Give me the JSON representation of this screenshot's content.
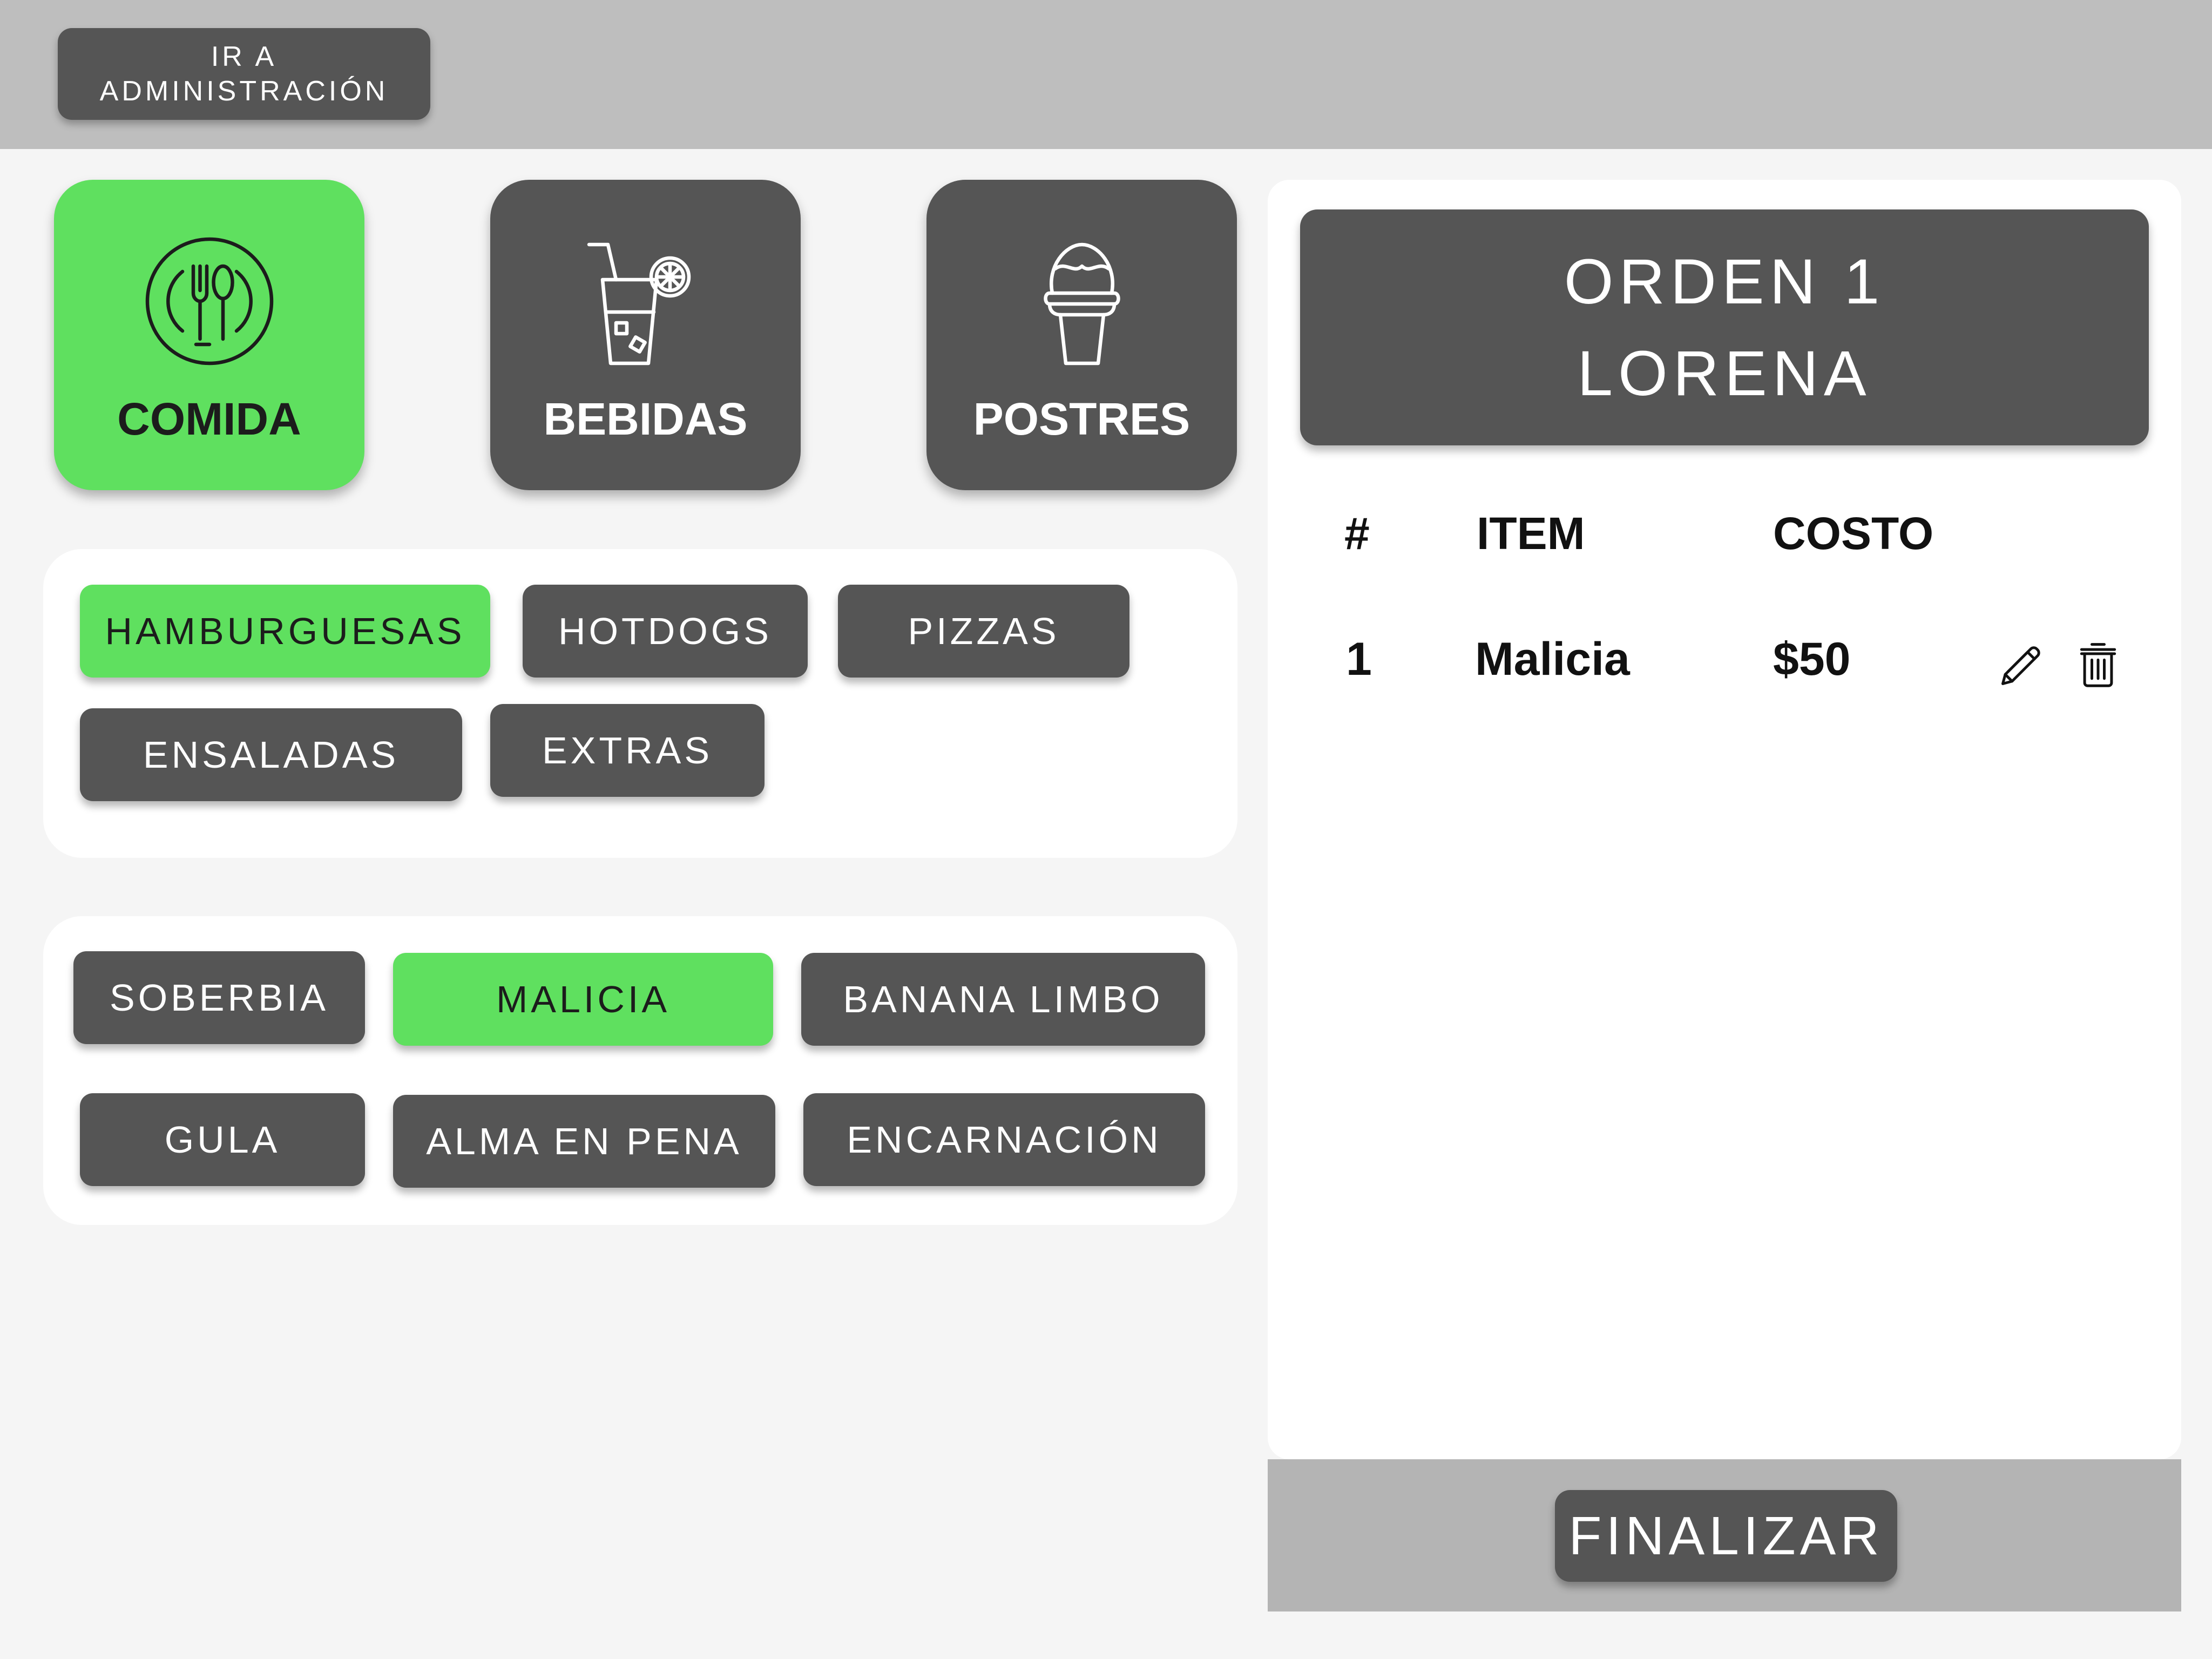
{
  "topbar": {
    "admin_button_line1": "IR A",
    "admin_button_line2": "ADMINISTRACIÓN"
  },
  "categories": [
    {
      "label": "COMIDA",
      "icon": "utensils-icon",
      "active": true
    },
    {
      "label": "BEBIDAS",
      "icon": "drink-icon",
      "active": false
    },
    {
      "label": "POSTRES",
      "icon": "ice-cream-icon",
      "active": false
    }
  ],
  "subcategories": [
    {
      "label": "HAMBURGUESAS",
      "active": true
    },
    {
      "label": "HOTDOGS",
      "active": false
    },
    {
      "label": "PIZZAS",
      "active": false
    },
    {
      "label": "ENSALADAS",
      "active": false
    },
    {
      "label": "EXTRAS",
      "active": false
    }
  ],
  "products": [
    {
      "label": "SOBERBIA",
      "active": false
    },
    {
      "label": "MALICIA",
      "active": true
    },
    {
      "label": "BANANA LIMBO",
      "active": false
    },
    {
      "label": "GULA",
      "active": false
    },
    {
      "label": "ALMA EN PENA",
      "active": false
    },
    {
      "label": "ENCARNACIÓN",
      "active": false
    }
  ],
  "order": {
    "title": "ORDEN 1",
    "customer": "LORENA",
    "columns": {
      "number": "#",
      "item": "ITEM",
      "cost": "COSTO"
    },
    "rows": [
      {
        "number": "1",
        "item": "Malicia",
        "cost": "$50",
        "actions": [
          "pencil-icon",
          "trash-icon"
        ]
      }
    ],
    "finalize_label": "FINALIZAR"
  },
  "colors": {
    "accent_green": "#5fe05f",
    "button_gray": "#555555",
    "topbar_gray": "#bebebe",
    "footer_gray": "#b4b4b4",
    "background": "#f5f5f5"
  }
}
